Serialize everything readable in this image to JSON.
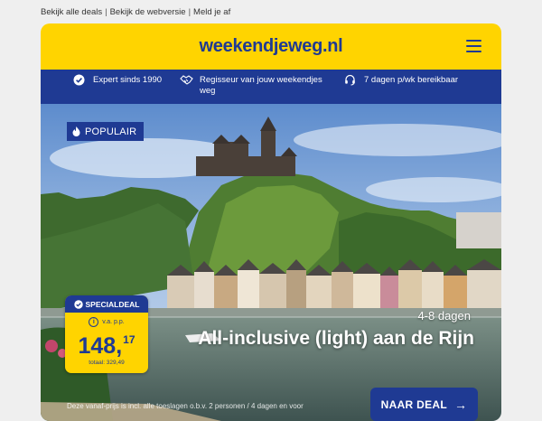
{
  "top_links": [
    {
      "label": "Bekijk alle deals"
    },
    {
      "label": "Bekijk de webversie"
    },
    {
      "label": "Meld je af"
    }
  ],
  "header": {
    "logo": "weekendjeweg.nl",
    "menu_icon": "hamburger-menu-icon",
    "brand_color": "#ffd400"
  },
  "usp_bar": {
    "color": "#1f3a93",
    "items": [
      {
        "icon": "check-circle-icon",
        "text": "Expert sinds 1990"
      },
      {
        "icon": "handshake-icon",
        "text": "Regisseur van jouw weekendjes weg"
      },
      {
        "icon": "headset-icon",
        "text": "7 dagen p/wk bereikbaar"
      }
    ]
  },
  "hero": {
    "badge": "POPULAIR",
    "deal": {
      "label": "SPECIALDEAL",
      "prefix": "v.a. p.p.",
      "price_main": "148,",
      "price_cents": "17",
      "total": "totaal: 329,49"
    },
    "duration": "4-8 dagen",
    "title": "All-inclusive (light) aan de Rijn",
    "cta": "NAAR DEAL",
    "fineprint": "Deze vanaf-prijs is incl. alle toeslagen o.b.v. 2 personen / 4 dagen en voor"
  }
}
